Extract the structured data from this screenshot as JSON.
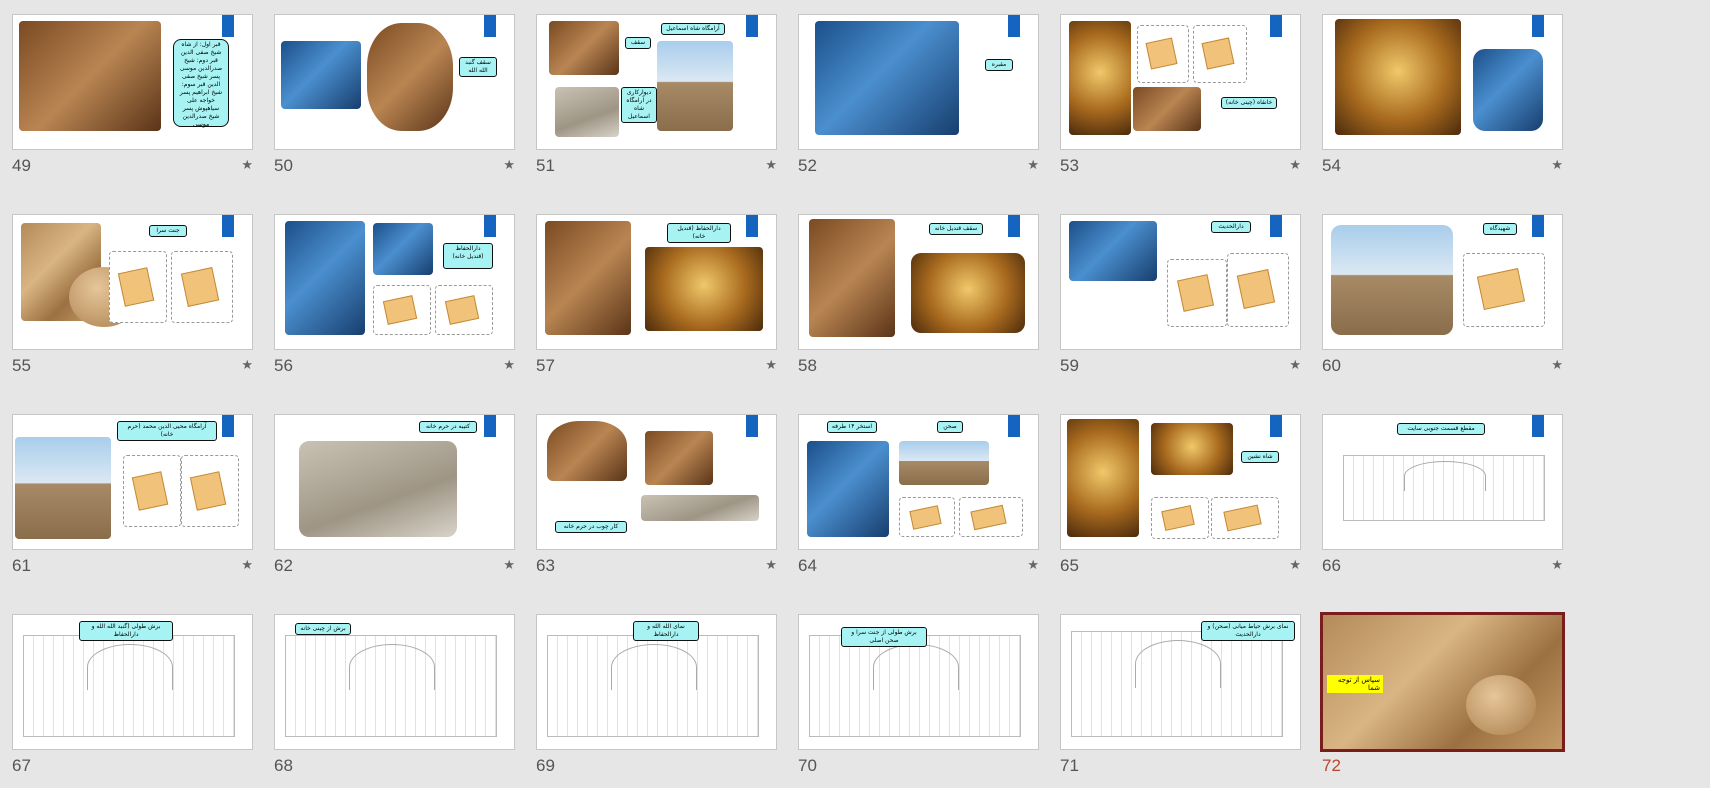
{
  "icons": {
    "transition": "star-icon"
  },
  "colors": {
    "accent_tag": "#1565c0",
    "label_fill": "#a7f3f3",
    "selected_border": "#7a1d1d",
    "selected_number": "#b7472a"
  },
  "slides": [
    {
      "number": "49",
      "star": "★",
      "labels": [
        "قبر اول: از شاه‌ شیخ صفی الدین قبر دوم: شیخ صدرالدین موسی پسر شیخ صفی الدین قبر سوم: شیخ ابراهیم پسر خواجه علی سیاهپوش پسر شیخ صدرالدین موسی"
      ]
    },
    {
      "number": "50",
      "star": "★",
      "labels": [
        "سقف گنبد الله الله"
      ]
    },
    {
      "number": "51",
      "star": "★",
      "labels": [
        "آرامگاه شاه اسماعیل",
        "سقف",
        "دیوارکاری در آرامگاه شاه اسماعیل"
      ]
    },
    {
      "number": "52",
      "star": "★",
      "labels": [
        "مقبره"
      ]
    },
    {
      "number": "53",
      "star": "★",
      "labels": [
        "خانقاه (چینی خانه)"
      ]
    },
    {
      "number": "54",
      "star": "★",
      "labels": []
    },
    {
      "number": "55",
      "star": "★",
      "labels": [
        "جنت سرا"
      ]
    },
    {
      "number": "56",
      "star": "★",
      "labels": [
        "دارالحفاظ (قندیل خانه)"
      ]
    },
    {
      "number": "57",
      "star": "★",
      "labels": [
        "دارالحفاظ (قندیل خانه)"
      ]
    },
    {
      "number": "58",
      "star": "",
      "labels": [
        "سقف قندیل خانه"
      ]
    },
    {
      "number": "59",
      "star": "★",
      "labels": [
        "دارالحدیث"
      ]
    },
    {
      "number": "60",
      "star": "★",
      "labels": [
        "شهیدگاه"
      ]
    },
    {
      "number": "61",
      "star": "★",
      "labels": [
        "آرامگاه محیی الدین محمد (حرم خانه)"
      ]
    },
    {
      "number": "62",
      "star": "★",
      "labels": [
        "کتیبه در حرم خانه"
      ]
    },
    {
      "number": "63",
      "star": "★",
      "labels": [
        "کار چوب در حرم خانه"
      ]
    },
    {
      "number": "64",
      "star": "★",
      "labels": [
        "صحن",
        "استخر ۱۴ طرفه"
      ]
    },
    {
      "number": "65",
      "star": "★",
      "labels": [
        "شاه نشین"
      ]
    },
    {
      "number": "66",
      "star": "★",
      "labels": [
        "مقطع قسمت جنوبی سایت"
      ]
    },
    {
      "number": "67",
      "star": "",
      "labels": [
        "برش طولی (گنبد الله الله و دارالحفاظ"
      ]
    },
    {
      "number": "68",
      "star": "",
      "labels": [
        "برش از چینی خانه"
      ]
    },
    {
      "number": "69",
      "star": "",
      "labels": [
        "نمای الله الله و دارالحفاظ"
      ]
    },
    {
      "number": "70",
      "star": "",
      "labels": [
        "برش طولی از جنت سرا و صحن اصلی"
      ]
    },
    {
      "number": "71",
      "star": "",
      "labels": [
        "نمای برش حیاط میانی (صحن) و دارالحدیث"
      ]
    },
    {
      "number": "72",
      "star": "",
      "labels": [
        "سپاس از توجه شما"
      ]
    }
  ]
}
